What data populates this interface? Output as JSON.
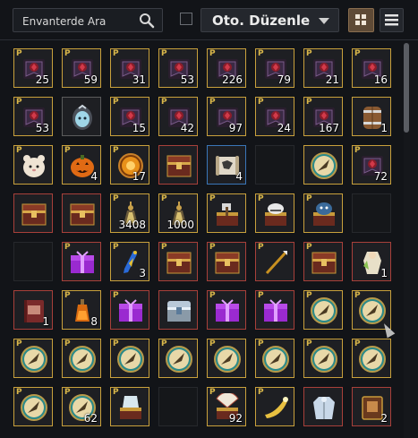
{
  "search": {
    "placeholder": "Envanterde Ara"
  },
  "toolbar": {
    "sort_label": "Oto. Düzenle"
  },
  "items": [
    {
      "type": "flag",
      "count": "25",
      "frame": "gold",
      "p": true
    },
    {
      "type": "flag",
      "count": "59",
      "frame": "gold",
      "p": true
    },
    {
      "type": "flag",
      "count": "31",
      "frame": "gold",
      "p": true
    },
    {
      "type": "flag",
      "count": "53",
      "frame": "gold",
      "p": true
    },
    {
      "type": "flag",
      "count": "226",
      "frame": "gold",
      "p": true
    },
    {
      "type": "flag",
      "count": "79",
      "frame": "gold",
      "p": true
    },
    {
      "type": "flag",
      "count": "21",
      "frame": "gold",
      "p": true
    },
    {
      "type": "flag",
      "count": "16",
      "frame": "gold",
      "p": true
    },
    {
      "type": "flag",
      "count": "53",
      "frame": "gold",
      "p": true
    },
    {
      "type": "egg",
      "count": "",
      "frame": "grey",
      "p": false
    },
    {
      "type": "flag",
      "count": "15",
      "frame": "gold",
      "p": true
    },
    {
      "type": "flag",
      "count": "42",
      "frame": "gold",
      "p": true
    },
    {
      "type": "flag",
      "count": "97",
      "frame": "gold",
      "p": true
    },
    {
      "type": "flag",
      "count": "24",
      "frame": "gold",
      "p": true
    },
    {
      "type": "flag",
      "count": "167",
      "frame": "gold",
      "p": true
    },
    {
      "type": "barrel",
      "count": "1",
      "frame": "gold",
      "p": false
    },
    {
      "type": "hamster",
      "count": "",
      "frame": "gold",
      "p": true
    },
    {
      "type": "pumpkin",
      "count": "4",
      "frame": "gold",
      "p": true
    },
    {
      "type": "amber",
      "count": "17",
      "frame": "gold",
      "p": true
    },
    {
      "type": "chest",
      "count": "",
      "frame": "red",
      "p": false
    },
    {
      "type": "scroll",
      "count": "4",
      "frame": "blue",
      "p": false
    },
    {
      "type": "empty",
      "count": "",
      "frame": "empty",
      "p": false
    },
    {
      "type": "compass",
      "count": "",
      "frame": "gold",
      "p": false
    },
    {
      "type": "flag",
      "count": "72",
      "frame": "gold",
      "p": true
    },
    {
      "type": "chest",
      "count": "",
      "frame": "red",
      "p": false
    },
    {
      "type": "chest",
      "count": "",
      "frame": "red",
      "p": false
    },
    {
      "type": "potion",
      "count": "3408",
      "frame": "gold",
      "p": true
    },
    {
      "type": "potion",
      "count": "1000",
      "frame": "gold",
      "p": true
    },
    {
      "type": "axechest",
      "count": "",
      "frame": "gold",
      "p": true
    },
    {
      "type": "helmchest",
      "count": "",
      "frame": "gold",
      "p": true
    },
    {
      "type": "wolfchest",
      "count": "",
      "frame": "gold",
      "p": true
    },
    {
      "type": "empty",
      "count": "",
      "frame": "empty",
      "p": false
    },
    {
      "type": "empty",
      "count": "",
      "frame": "empty",
      "p": false
    },
    {
      "type": "gift",
      "count": "",
      "frame": "red",
      "p": true
    },
    {
      "type": "vial",
      "count": "3",
      "frame": "gold",
      "p": true
    },
    {
      "type": "chest",
      "count": "",
      "frame": "red",
      "p": true
    },
    {
      "type": "chest",
      "count": "",
      "frame": "red",
      "p": true
    },
    {
      "type": "spear",
      "count": "",
      "frame": "red",
      "p": true
    },
    {
      "type": "chest",
      "count": "",
      "frame": "red",
      "p": true
    },
    {
      "type": "costume",
      "count": "1",
      "frame": "red",
      "p": false
    },
    {
      "type": "book",
      "count": "1",
      "frame": "red",
      "p": false
    },
    {
      "type": "elixir",
      "count": "8",
      "frame": "gold",
      "p": true
    },
    {
      "type": "gift",
      "count": "",
      "frame": "red",
      "p": true
    },
    {
      "type": "silverchest",
      "count": "",
      "frame": "red",
      "p": false
    },
    {
      "type": "gift",
      "count": "",
      "frame": "red",
      "p": true
    },
    {
      "type": "gift",
      "count": "",
      "frame": "red",
      "p": true
    },
    {
      "type": "compass",
      "count": "",
      "frame": "gold",
      "p": true
    },
    {
      "type": "compass",
      "count": "",
      "frame": "gold",
      "p": true
    },
    {
      "type": "compass",
      "count": "",
      "frame": "gold",
      "p": true
    },
    {
      "type": "compass",
      "count": "",
      "frame": "gold",
      "p": true
    },
    {
      "type": "compass",
      "count": "",
      "frame": "gold",
      "p": true
    },
    {
      "type": "compass",
      "count": "",
      "frame": "gold",
      "p": true
    },
    {
      "type": "compass",
      "count": "",
      "frame": "gold",
      "p": true
    },
    {
      "type": "compass",
      "count": "",
      "frame": "gold",
      "p": true
    },
    {
      "type": "compass",
      "count": "",
      "frame": "gold",
      "p": true
    },
    {
      "type": "compass",
      "count": "",
      "frame": "gold",
      "p": true
    },
    {
      "type": "compass",
      "count": "",
      "frame": "gold",
      "p": true
    },
    {
      "type": "compass",
      "count": "62",
      "frame": "gold",
      "p": true
    },
    {
      "type": "coatchest",
      "count": "",
      "frame": "gold",
      "p": true
    },
    {
      "type": "empty",
      "count": "",
      "frame": "empty",
      "p": false
    },
    {
      "type": "fanchest",
      "count": "92",
      "frame": "gold",
      "p": true
    },
    {
      "type": "horn",
      "count": "",
      "frame": "gold",
      "p": true
    },
    {
      "type": "coat",
      "count": "",
      "frame": "red",
      "p": false
    },
    {
      "type": "tome",
      "count": "2",
      "frame": "red",
      "p": false
    }
  ]
}
